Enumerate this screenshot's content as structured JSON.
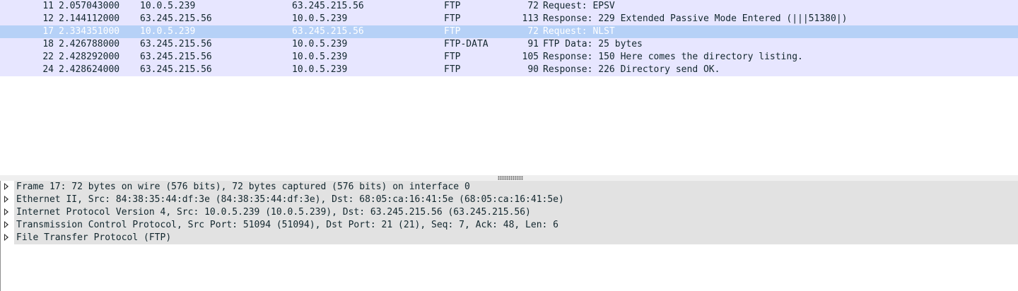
{
  "packet_list": {
    "rows": [
      {
        "no": "11",
        "time": "2.057043000",
        "src": "10.0.5.239",
        "dst": "63.245.215.56",
        "proto": "FTP",
        "len": "72",
        "info": "Request: EPSV",
        "selected": false
      },
      {
        "no": "12",
        "time": "2.144112000",
        "src": "63.245.215.56",
        "dst": "10.0.5.239",
        "proto": "FTP",
        "len": "113",
        "info": "Response: 229 Extended Passive Mode Entered (|||51380|)",
        "selected": false
      },
      {
        "no": "17",
        "time": "2.334351000",
        "src": "10.0.5.239",
        "dst": "63.245.215.56",
        "proto": "FTP",
        "len": "72",
        "info": "Request: NLST",
        "selected": true
      },
      {
        "no": "18",
        "time": "2.426788000",
        "src": "63.245.215.56",
        "dst": "10.0.5.239",
        "proto": "FTP-DATA",
        "len": "91",
        "info": "FTP Data: 25 bytes",
        "selected": false
      },
      {
        "no": "22",
        "time": "2.428292000",
        "src": "63.245.215.56",
        "dst": "10.0.5.239",
        "proto": "FTP",
        "len": "105",
        "info": "Response: 150 Here comes the directory listing.",
        "selected": false
      },
      {
        "no": "24",
        "time": "2.428624000",
        "src": "63.245.215.56",
        "dst": "10.0.5.239",
        "proto": "FTP",
        "len": "90",
        "info": "Response: 226 Directory send OK.",
        "selected": false
      }
    ],
    "colors": {
      "ftp_row": "#e7e6ff",
      "selected_row": "#b6d1f7",
      "selected_text": "#ffffff"
    }
  },
  "details": {
    "items": [
      {
        "text": "Frame 17: 72 bytes on wire (576 bits), 72 bytes captured (576 bits) on interface 0",
        "icon": "expand-arrow-icon"
      },
      {
        "text": "Ethernet II, Src: 84:38:35:44:df:3e (84:38:35:44:df:3e), Dst: 68:05:ca:16:41:5e (68:05:ca:16:41:5e)",
        "icon": "expand-arrow-icon"
      },
      {
        "text": "Internet Protocol Version 4, Src: 10.0.5.239 (10.0.5.239), Dst: 63.245.215.56 (63.245.215.56)",
        "icon": "expand-arrow-icon"
      },
      {
        "text": "Transmission Control Protocol, Src Port: 51094 (51094), Dst Port: 21 (21), Seq: 7, Ack: 48, Len: 6",
        "icon": "expand-arrow-icon"
      },
      {
        "text": "File Transfer Protocol (FTP)",
        "icon": "expand-arrow-icon"
      }
    ]
  }
}
